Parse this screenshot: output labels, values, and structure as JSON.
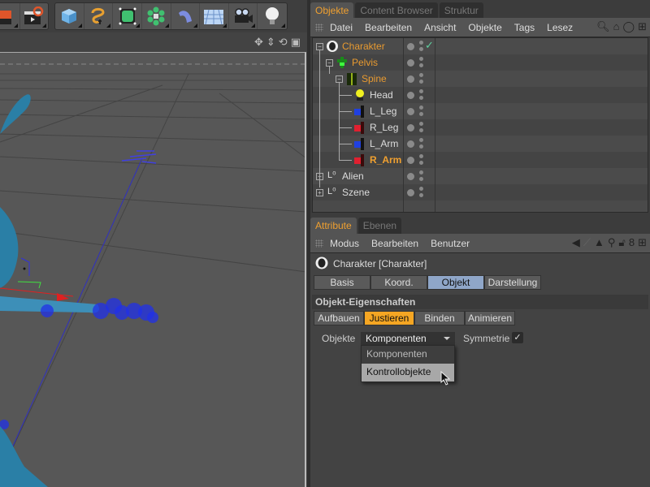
{
  "toolbar": {
    "left_icons": [
      "render-settings-icon",
      "render-to-picture-viewer-icon"
    ],
    "create_icons": [
      "cube-icon",
      "spline-icon",
      "subdivision-icon",
      "array-icon",
      "deformer-icon",
      "floor-icon",
      "camera-icon",
      "light-icon"
    ]
  },
  "viewport": {
    "header_icons": [
      "move-view-icon",
      "zoom-view-icon",
      "rotate-view-icon",
      "maximize-view-icon"
    ]
  },
  "object_manager": {
    "tabs": [
      {
        "label": "Objekte",
        "active": true
      },
      {
        "label": "Content Browser",
        "active": false
      },
      {
        "label": "Struktur",
        "active": false
      }
    ],
    "menu": [
      "Datei",
      "Bearbeiten",
      "Ansicht",
      "Objekte",
      "Tags",
      "Lesez"
    ],
    "objects": [
      {
        "name": "Charakter",
        "depth": 0,
        "selected": true,
        "icon": "character-icon",
        "toggle": "-",
        "check": true
      },
      {
        "name": "Pelvis",
        "depth": 1,
        "selected": true,
        "icon": "pelvis-icon",
        "toggle": "-"
      },
      {
        "name": "Spine",
        "depth": 2,
        "selected": true,
        "icon": "spine-icon",
        "toggle": "-"
      },
      {
        "name": "Head",
        "depth": 3,
        "selected": false,
        "icon": "head-icon"
      },
      {
        "name": "L_Leg",
        "depth": 3,
        "selected": false,
        "icon": "left-leg-icon"
      },
      {
        "name": "R_Leg",
        "depth": 3,
        "selected": false,
        "icon": "right-leg-icon"
      },
      {
        "name": "L_Arm",
        "depth": 3,
        "selected": false,
        "icon": "left-arm-icon"
      },
      {
        "name": "R_Arm",
        "depth": 3,
        "selected": true,
        "active": true,
        "icon": "right-arm-icon"
      },
      {
        "name": "Alien",
        "depth": 0,
        "selected": false,
        "icon": "null-object-icon",
        "toggle": "+"
      },
      {
        "name": "Szene",
        "depth": 0,
        "selected": false,
        "icon": "null-object-icon",
        "toggle": "+"
      }
    ]
  },
  "attribute_manager": {
    "tabs": [
      {
        "label": "Attribute",
        "active": true
      },
      {
        "label": "Ebenen",
        "active": false
      }
    ],
    "menu": [
      "Modus",
      "Bearbeiten",
      "Benutzer"
    ],
    "object_title": "Charakter [Charakter]",
    "main_tabs": [
      "Basis",
      "Koord.",
      "Objekt",
      "Darstellung"
    ],
    "main_tab_active": "Objekt",
    "section_title": "Objekt-Eigenschaften",
    "sub_tabs": [
      "Aufbauen",
      "Justieren",
      "Binden",
      "Animieren"
    ],
    "sub_tab_active": "Justieren",
    "objekte_label": "Objekte",
    "objekte_value": "Komponenten",
    "objekte_options": [
      "Komponenten",
      "Kontrollobjekte"
    ],
    "highlighted_option": "Kontrollobjekte",
    "symmetrie_label": "Symmetrie",
    "symmetrie_checked": true,
    "check_glyph": "✓"
  }
}
